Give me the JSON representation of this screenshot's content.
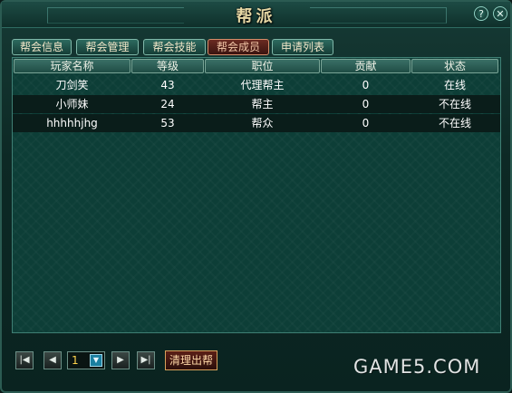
{
  "window": {
    "title": "帮派",
    "help_label": "?",
    "close_label": "✕"
  },
  "tabs": [
    {
      "label": "帮会信息",
      "active": false
    },
    {
      "label": "帮会管理",
      "active": false
    },
    {
      "label": "帮会技能",
      "active": false
    },
    {
      "label": "帮会成员",
      "active": true
    },
    {
      "label": "申请列表",
      "active": false
    }
  ],
  "table": {
    "columns": [
      "玩家名称",
      "等级",
      "职位",
      "贡献",
      "状态"
    ],
    "rows": [
      {
        "name": "刀剑笑",
        "level": "43",
        "position": "代理帮主",
        "contribution": "0",
        "status": "在线"
      },
      {
        "name": "小师妹",
        "level": "24",
        "position": "帮主",
        "contribution": "0",
        "status": "不在线"
      },
      {
        "name": "hhhhhjhg",
        "level": "53",
        "position": "帮众",
        "contribution": "0",
        "status": "不在线"
      }
    ]
  },
  "pager": {
    "first_label": "|◀",
    "prev_label": "◀",
    "page_value": "1",
    "dropdown_label": "▼",
    "next_label": "▶",
    "last_label": "▶|"
  },
  "actions": {
    "kick_label": "清理出帮"
  },
  "watermark": "GAME5.COM"
}
